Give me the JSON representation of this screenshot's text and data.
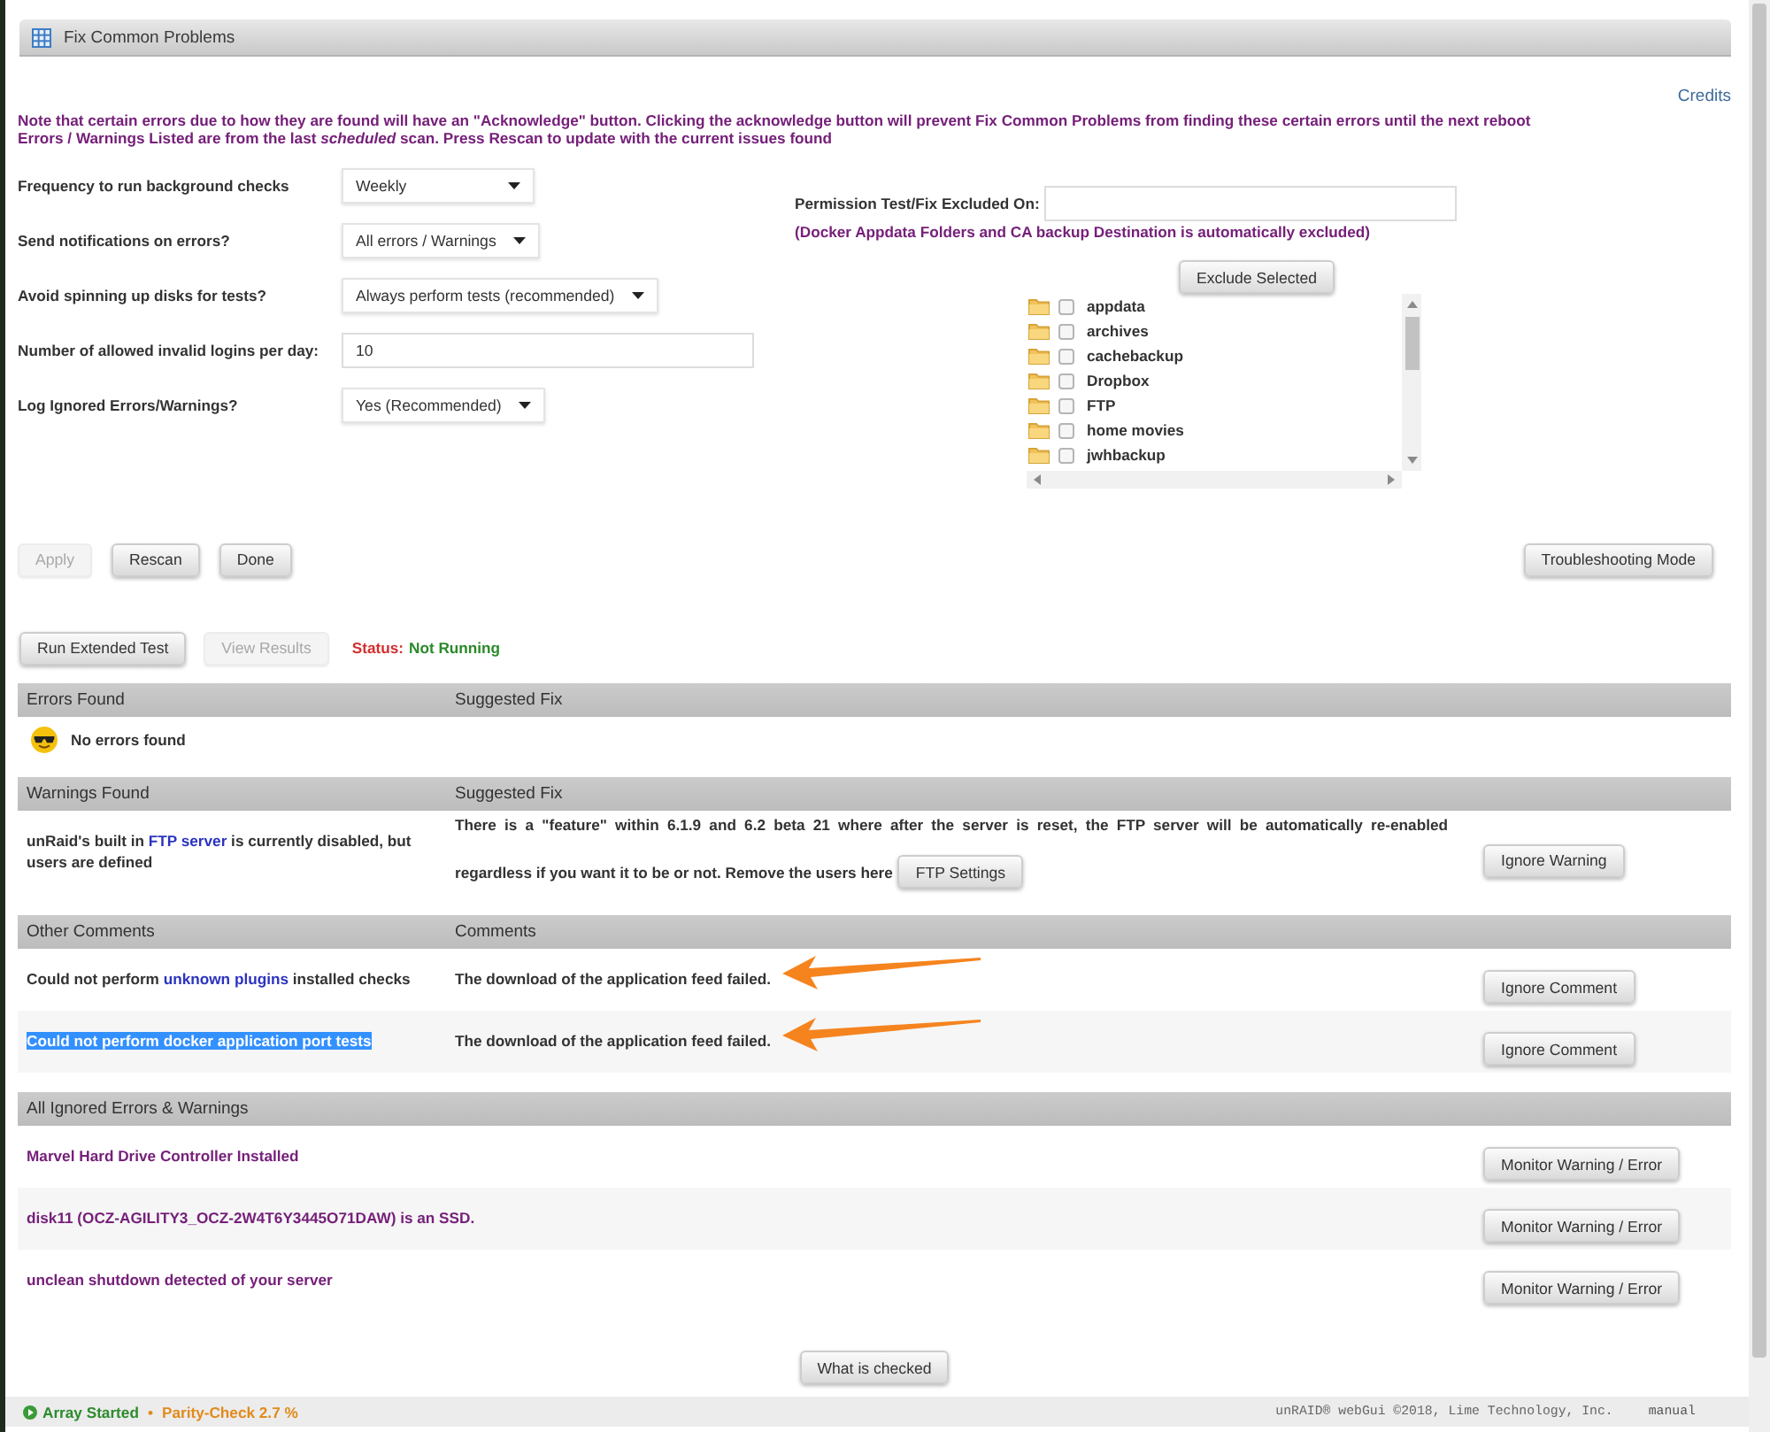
{
  "window": {
    "title": "Fix Common Problems",
    "credits": "Credits"
  },
  "notes": [
    "Note that certain errors due to how they are found will have an \"Acknowledge\" button. Clicking the acknowledge button will prevent Fix Common Problems from finding these certain errors until the next reboot",
    "Errors / Warnings Listed are from the last *scheduled* scan. Press Rescan to update with the current issues found"
  ],
  "settings": [
    {
      "kind": "select",
      "label": "Frequency to run background checks",
      "value": "Weekly"
    },
    {
      "kind": "select",
      "label": "Send notifications on errors?",
      "value": "All errors / Warnings"
    },
    {
      "kind": "select",
      "label": "Avoid spinning up disks for tests?",
      "value": "Always perform tests (recommended)"
    },
    {
      "kind": "input",
      "label": "Number of allowed invalid logins per day:",
      "value": "10"
    },
    {
      "kind": "select",
      "label": "Log Ignored Errors/Warnings?",
      "value": "Yes (Recommended)"
    }
  ],
  "exclusion": {
    "label": "Permission Test/Fix Excluded On:",
    "note": "(Docker Appdata Folders and CA backup Destination is automatically excluded)",
    "button": "Exclude Selected",
    "folders": [
      {
        "name": "appdata",
        "checked": false
      },
      {
        "name": "archives",
        "checked": false
      },
      {
        "name": "cachebackup",
        "checked": false
      },
      {
        "name": "Dropbox",
        "checked": false
      },
      {
        "name": "FTP",
        "checked": false
      },
      {
        "name": "home movies",
        "checked": false
      },
      {
        "name": "jwhbackup",
        "checked": false
      }
    ]
  },
  "actions": [
    {
      "label": "Apply",
      "disabled": true
    },
    {
      "label": "Rescan",
      "disabled": false
    },
    {
      "label": "Done",
      "disabled": false
    }
  ],
  "troubleshooting": {
    "label": "Troubleshooting Mode"
  },
  "extended_test": {
    "buttons": [
      {
        "label": "Run Extended Test",
        "disabled": false
      },
      {
        "label": "View Results",
        "disabled": true
      }
    ],
    "status_label": "Status:",
    "status": "Not Running"
  },
  "sections": [
    {
      "columns": [
        "Errors Found",
        "Suggested Fix"
      ],
      "rows": [
        {
          "kind": "empty",
          "text": "No errors found"
        }
      ]
    },
    {
      "columns": [
        "Warnings Found",
        "Suggested Fix"
      ],
      "rows": [
        {
          "kind": "issue",
          "issue": [
            {
              "kind": "text",
              "text": "unRaid's built in "
            },
            {
              "kind": "link",
              "text": "FTP server"
            },
            {
              "kind": "text",
              "text": " is currently disabled, but users are defined"
            }
          ],
          "fix_lines": [
            "There is a \"feature\" within 6.1.9 and 6.2 beta 21 where after the server is reset, the FTP server will be automatically re-enabled",
            "regardless if you want it to be or not. Remove the users here"
          ],
          "fix_button": "FTP Settings",
          "action": "Ignore Warning"
        }
      ]
    },
    {
      "columns": [
        "Other Comments",
        "Comments"
      ],
      "rows": [
        {
          "kind": "issue",
          "issue": [
            {
              "kind": "text",
              "text": "Could not perform "
            },
            {
              "kind": "link",
              "text": "unknown plugins"
            },
            {
              "kind": "text",
              "text": " installed checks"
            }
          ],
          "fix": "The download of the application feed failed.",
          "action": "Ignore Comment",
          "text_selected": false,
          "arrow": true
        },
        {
          "kind": "issue",
          "issue": [
            {
              "kind": "text",
              "text": "Could not perform docker application port tests"
            }
          ],
          "fix": "The download of the application feed failed.",
          "action": "Ignore Comment",
          "text_selected": true,
          "arrow": true
        }
      ]
    },
    {
      "columns": [
        "All Ignored Errors & Warnings"
      ],
      "rows": [
        {
          "kind": "ignored",
          "text": "Marvel Hard Drive Controller Installed",
          "action": "Monitor Warning / Error"
        },
        {
          "kind": "ignored",
          "text": "disk11 (OCZ-AGILITY3_OCZ-2W4T6Y3445O71DAW) is an SSD.",
          "action": "Monitor Warning / Error"
        },
        {
          "kind": "ignored",
          "text": "unclean shutdown detected of your server",
          "action": "Monitor Warning / Error"
        }
      ]
    }
  ],
  "footer_button": "What is checked",
  "status_bar": {
    "array": "Array Started",
    "separator": "•",
    "parity": "Parity-Check 2.7 %",
    "copyright": "unRAID® webGui ©2018, Lime Technology, Inc.",
    "manual": "manual"
  }
}
